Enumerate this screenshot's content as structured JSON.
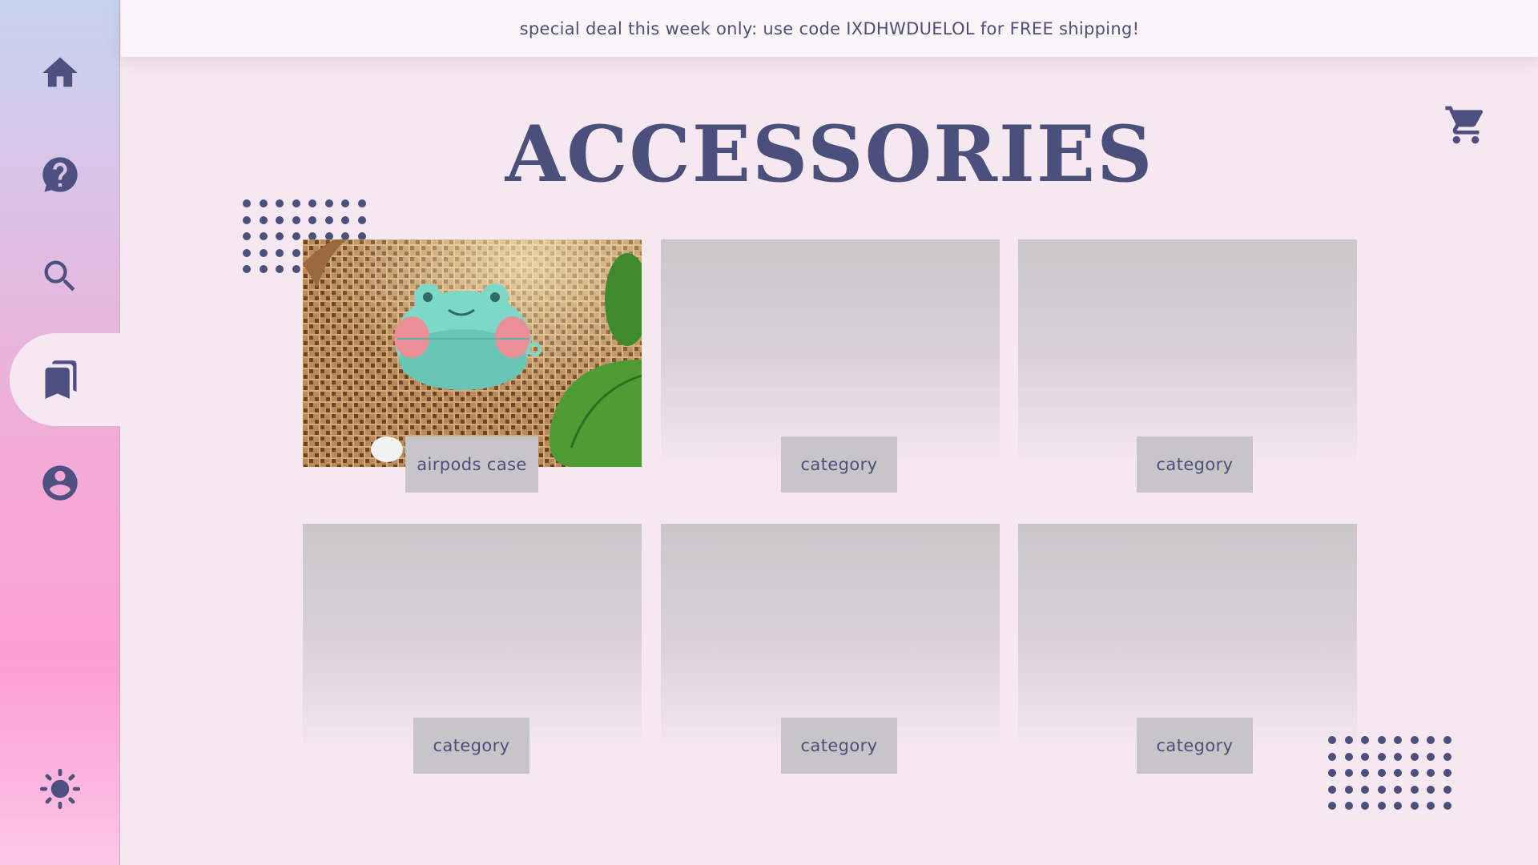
{
  "banner": {
    "text": "special deal this week only: use code IXDHWDUELOL for FREE shipping!"
  },
  "page": {
    "title": "ACCESSORIES"
  },
  "sidebar": {
    "items": [
      {
        "icon": "home-icon"
      },
      {
        "icon": "help-icon"
      },
      {
        "icon": "search-icon"
      },
      {
        "icon": "bookmarks-icon",
        "active": true
      },
      {
        "icon": "account-icon"
      },
      {
        "icon": "brightness-icon"
      }
    ]
  },
  "header": {
    "cart_icon": "cart-icon"
  },
  "grid": {
    "cards": [
      {
        "label": "airpods case",
        "image": "frog-airpods-case-photo"
      },
      {
        "label": "category"
      },
      {
        "label": "category"
      },
      {
        "label": "category"
      },
      {
        "label": "category"
      },
      {
        "label": "category"
      }
    ]
  },
  "colors": {
    "accent": "#4a4f7c",
    "background": "#f5e8f0",
    "banner": "#fbf4f8",
    "card_label": "#c8c5c8"
  }
}
